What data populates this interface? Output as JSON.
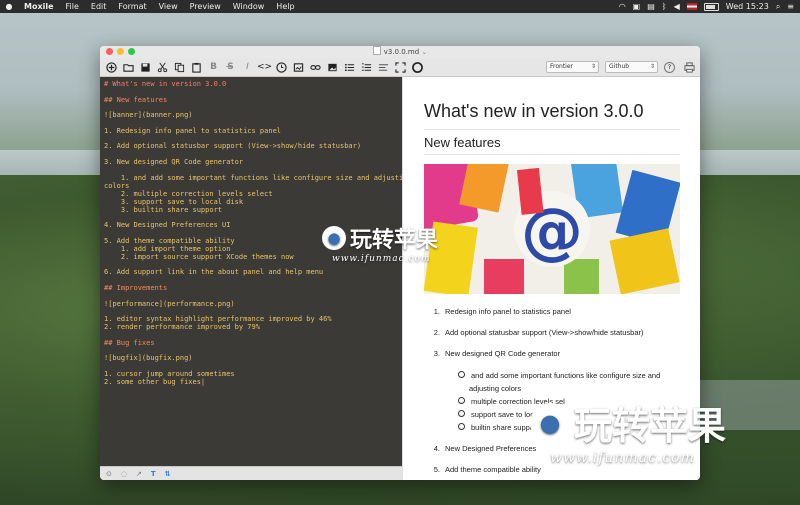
{
  "menubar": {
    "app": "Moxile",
    "items": [
      "File",
      "Edit",
      "Format",
      "View",
      "Preview",
      "Window",
      "Help"
    ],
    "clock": "Wed 15:23"
  },
  "window": {
    "title": "v3.0.0.md",
    "theme_options": {
      "editor_theme": "Frontier",
      "preview_theme": "Github"
    },
    "toolbar_icons": [
      "new-icon",
      "open-folder-icon",
      "save-icon",
      "cut-icon",
      "copy-icon",
      "paste-icon",
      "bold-icon",
      "strikethrough-icon",
      "italic-icon",
      "code-icon",
      "clock-icon",
      "image-icon",
      "link-icon",
      "picture-icon",
      "bullet-list-icon",
      "numbered-list-icon",
      "align-icon",
      "fullscreen-icon",
      "theme-icon"
    ],
    "toolbar_text": {
      "bold": "B",
      "strike": "S̶",
      "italic": "I",
      "code": "<>"
    }
  },
  "editor": {
    "lines": [
      {
        "t": "# What's new in version 3.0.0",
        "k": "h1"
      },
      {
        "t": "",
        "k": "blank"
      },
      {
        "t": "## New features",
        "k": "h"
      },
      {
        "t": "",
        "k": "blank"
      },
      {
        "t": "![banner](banner.png)",
        "k": "p"
      },
      {
        "t": "",
        "k": "blank"
      },
      {
        "t": "1. Redesign info panel to statistics panel",
        "k": "p"
      },
      {
        "t": "",
        "k": "blank"
      },
      {
        "t": "2. Add optional statusbar support (View->show/hide statusbar)",
        "k": "p"
      },
      {
        "t": "",
        "k": "blank"
      },
      {
        "t": "3. New designed QR Code generator",
        "k": "p"
      },
      {
        "t": "",
        "k": "blank"
      },
      {
        "t": "    1. and add some important functions like configure size and adjusting",
        "k": "p"
      },
      {
        "t": "colors",
        "k": "p"
      },
      {
        "t": "    2. multiple correction levels select",
        "k": "p"
      },
      {
        "t": "    3. support save to local disk",
        "k": "p"
      },
      {
        "t": "    3. builtin share support",
        "k": "p"
      },
      {
        "t": "",
        "k": "blank"
      },
      {
        "t": "4. New Designed Preferences UI",
        "k": "p"
      },
      {
        "t": "",
        "k": "blank"
      },
      {
        "t": "5. Add theme compatible ability",
        "k": "p"
      },
      {
        "t": "    1. add import theme option",
        "k": "p"
      },
      {
        "t": "    2. import source support XCode themes now",
        "k": "p"
      },
      {
        "t": "",
        "k": "blank"
      },
      {
        "t": "6. Add support link in the about panel and help menu",
        "k": "p"
      },
      {
        "t": "",
        "k": "blank"
      },
      {
        "t": "## Improvements",
        "k": "h"
      },
      {
        "t": "",
        "k": "blank"
      },
      {
        "t": "![performance](performance.png)",
        "k": "p"
      },
      {
        "t": "",
        "k": "blank"
      },
      {
        "t": "1. editor syntax highlight performance improved by 46%",
        "k": "p"
      },
      {
        "t": "2. render performance improved by 79%",
        "k": "p"
      },
      {
        "t": "",
        "k": "blank"
      },
      {
        "t": "## Bug fixes",
        "k": "h"
      },
      {
        "t": "",
        "k": "blank"
      },
      {
        "t": "![bugfix](bugfix.png)",
        "k": "p"
      },
      {
        "t": "",
        "k": "blank"
      },
      {
        "t": "1. cursor jump around sometimes",
        "k": "p"
      },
      {
        "t": "2. some other bug fixes|",
        "k": "p"
      }
    ]
  },
  "preview": {
    "h1": "What's new in version 3.0.0",
    "h2": "New features",
    "list": [
      {
        "n": "1.",
        "t": "Redesign info panel to statistics panel"
      },
      {
        "n": "2.",
        "t": "Add optional statusbar support (View->show/hide statusbar)"
      },
      {
        "n": "3.",
        "t": "New designed QR Code generator"
      },
      {
        "n": "4.",
        "t": "New Designed Preferences"
      },
      {
        "n": "5.",
        "t": "Add theme compatible ability"
      }
    ],
    "sublist": [
      "and add some important functions like configure size and",
      "adjusting colors",
      "multiple correction levels sel",
      "support save to local",
      "builtin share support"
    ]
  },
  "watermark": {
    "brand": "玩转苹果",
    "url": "www.ifunmac.com"
  },
  "colors": {
    "editor_bg": "#3c3a36",
    "editor_text": "#e9c46a",
    "editor_heading": "#f08a5d",
    "statusbar_accent": "#2e7fd6"
  }
}
